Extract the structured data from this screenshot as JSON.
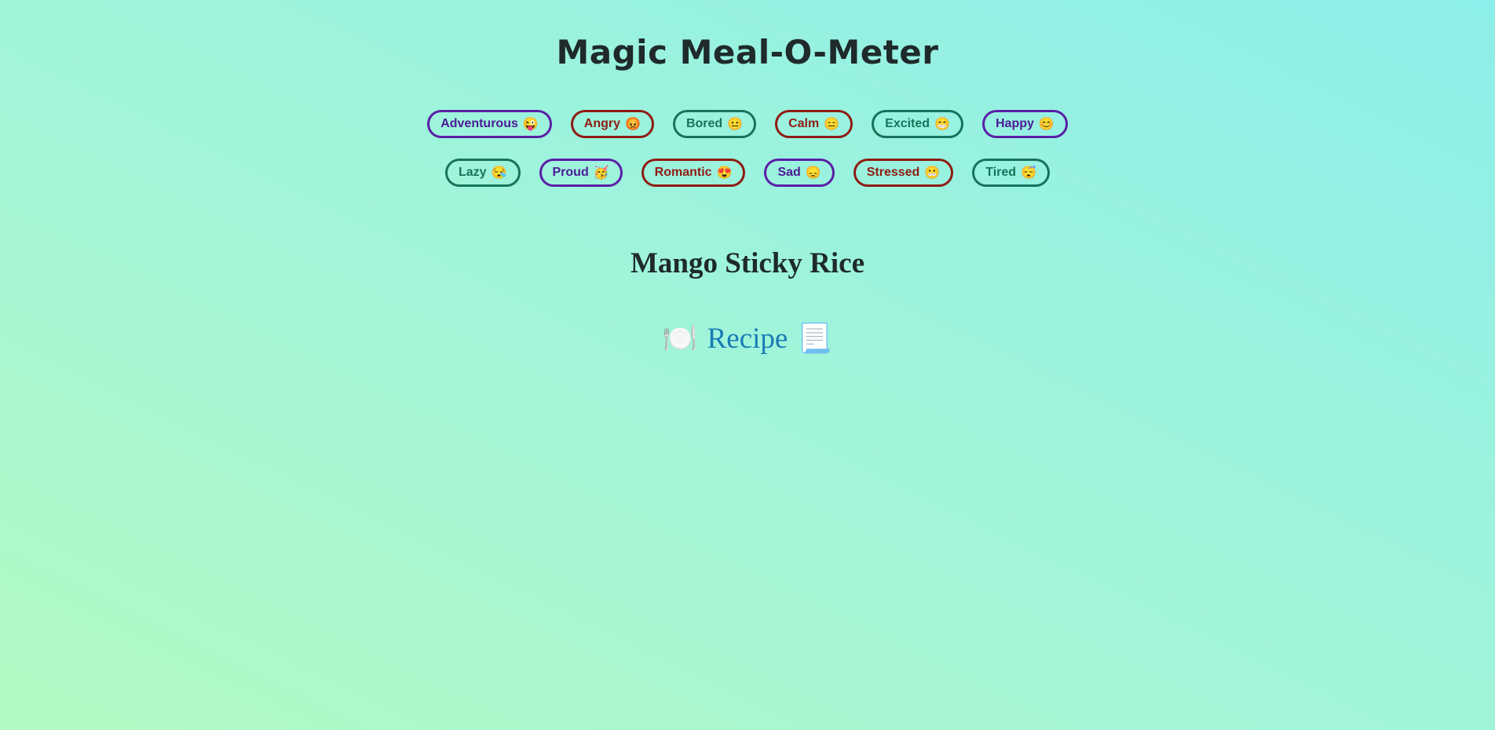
{
  "app": {
    "title": "Magic Meal-O-Meter"
  },
  "moods": {
    "row1": [
      {
        "label": "Adventurous",
        "emoji": "😜",
        "color": "#5a1fa6"
      },
      {
        "label": "Angry",
        "emoji": "😡",
        "color": "#8e1c12"
      },
      {
        "label": "Bored",
        "emoji": "😐",
        "color": "#17735c"
      },
      {
        "label": "Calm",
        "emoji": "😑",
        "color": "#8e1c12"
      },
      {
        "label": "Excited",
        "emoji": "😁",
        "color": "#17735c"
      },
      {
        "label": "Happy",
        "emoji": "😊",
        "color": "#5a1fa6"
      }
    ],
    "row2": [
      {
        "label": "Lazy",
        "emoji": "😪",
        "color": "#17735c"
      },
      {
        "label": "Proud",
        "emoji": "🥳",
        "color": "#5a1fa6"
      },
      {
        "label": "Romantic",
        "emoji": "😍",
        "color": "#8e1c12"
      },
      {
        "label": "Sad",
        "emoji": "😞",
        "color": "#5a1fa6"
      },
      {
        "label": "Stressed",
        "emoji": "😬",
        "color": "#8e1c12"
      },
      {
        "label": "Tired",
        "emoji": "😴",
        "color": "#17735c"
      }
    ]
  },
  "result": {
    "meal_name": "Mango Sticky Rice",
    "recipe_label": "Recipe",
    "left_icon": "🍽️",
    "right_icon": "📃"
  },
  "colors": {
    "purple": "#5a1fa6",
    "red": "#8e1c12",
    "green": "#17735c",
    "link": "#1a7bb3",
    "background_start": "#b3f9c3",
    "background_end": "#8eeee9"
  }
}
